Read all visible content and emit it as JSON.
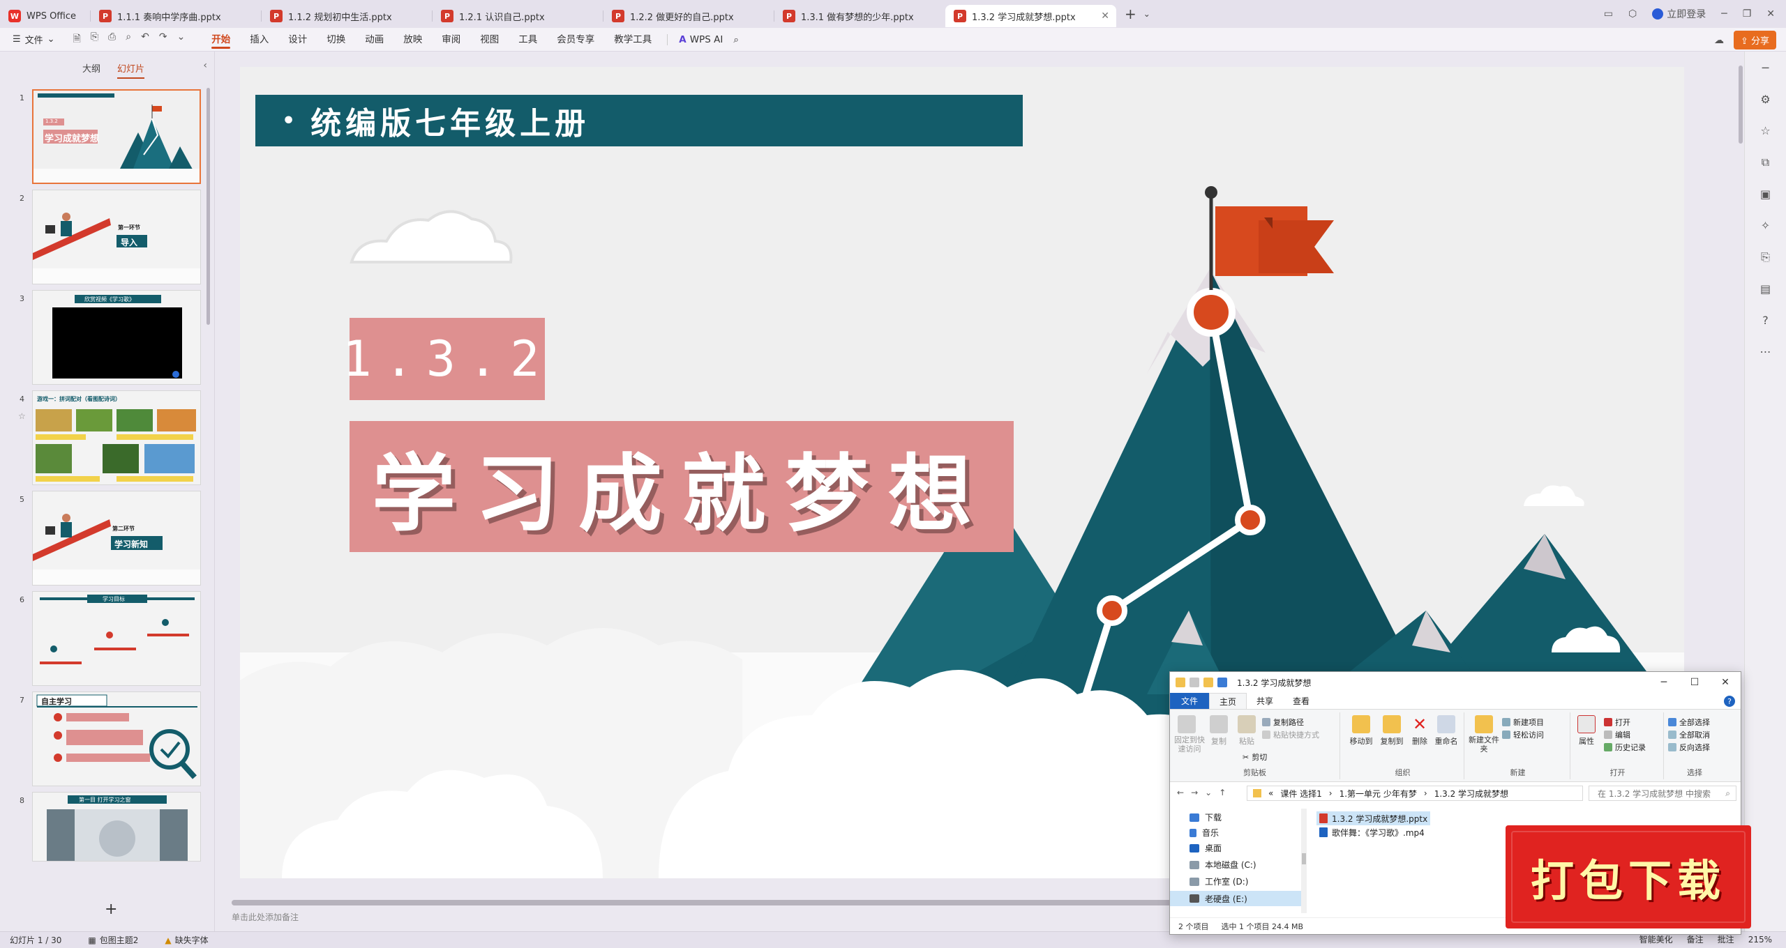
{
  "tabbar": {
    "home_tab": "WPS Office",
    "tabs": [
      {
        "label": "1.1.1 奏响中学序曲.pptx"
      },
      {
        "label": "1.1.2 规划初中生活.pptx"
      },
      {
        "label": "1.2.1 认识自己.pptx"
      },
      {
        "label": "1.2.2 做更好的自己.pptx"
      },
      {
        "label": "1.3.1 做有梦想的少年.pptx"
      },
      {
        "label": "1.3.2 学习成就梦想.pptx"
      }
    ],
    "login_label": "立即登录"
  },
  "menubar": {
    "file_label": "文件",
    "items": [
      "开始",
      "插入",
      "设计",
      "切换",
      "动画",
      "放映",
      "审阅",
      "视图",
      "工具",
      "会员专享",
      "教学工具"
    ],
    "active_item": "开始",
    "ai_label": "WPS AI",
    "share_label": "分享"
  },
  "left_panel": {
    "tab_outline": "大纲",
    "tab_slides": "幻灯片",
    "thumbs": [
      {
        "num": "1",
        "title": "学习成就梦想",
        "num_label": "1.3.2"
      },
      {
        "num": "2",
        "section": "第一环节",
        "label": "导入"
      },
      {
        "num": "3",
        "title": "欣赏视频《学习歌》"
      },
      {
        "num": "4",
        "title": "游戏一：拼词配对（看图配诗词）"
      },
      {
        "num": "5",
        "section": "第二环节",
        "label": "学习新知"
      },
      {
        "num": "6",
        "title": "学习目标"
      },
      {
        "num": "7",
        "title": "自主学习"
      },
      {
        "num": "8",
        "title": "第一目 打开学习之窗"
      }
    ],
    "add_label": "+"
  },
  "slide": {
    "subject": "统编版七年级上册",
    "lesson_number": "1.3.2",
    "lesson_title": "学习成就梦想"
  },
  "notes_placeholder": "单击此处添加备注",
  "statusbar": {
    "slide_count": "幻灯片 1 / 30",
    "theme": "包图主题2",
    "missing_font": "缺失字体",
    "smart_beautify": "智能美化",
    "notes": "备注",
    "comments": "批注",
    "zoom": "215%"
  },
  "explorer": {
    "title": "1.3.2 学习成就梦想",
    "ribbon_tabs": [
      "文件",
      "主页",
      "共享",
      "查看"
    ],
    "groups": {
      "clipboard": "剪贴板",
      "organize": "组织",
      "new": "新建",
      "open": "打开",
      "select": "选择"
    },
    "buttons": {
      "pin": "固定到快速访问",
      "copy": "复制",
      "paste": "粘贴",
      "copy_path": "复制路径",
      "paste_shortcut": "粘贴快捷方式",
      "cut": "剪切",
      "move_to": "移动到",
      "copy_to": "复制到",
      "delete": "删除",
      "rename": "重命名",
      "new_folder": "新建文件夹",
      "new_item": "新建项目",
      "easy_access": "轻松访问",
      "properties": "属性",
      "open": "打开",
      "edit": "编辑",
      "history": "历史记录",
      "select_all": "全部选择",
      "select_none": "全部取消",
      "invert": "反向选择"
    },
    "path": [
      "课件 选择1",
      "1.第一单元 少年有梦",
      "1.3.2 学习成就梦想"
    ],
    "search_placeholder": "在 1.3.2 学习成就梦想 中搜索",
    "nav": [
      "下载",
      "音乐",
      "桌面",
      "本地磁盘 (C:)",
      "工作室 (D:)",
      "老硬盘 (E:)"
    ],
    "nav_selected": "老硬盘 (E:)",
    "files": [
      {
        "name": "1.3.2 学习成就梦想.pptx",
        "type": "pptx",
        "selected": true
      },
      {
        "name": "歌伴舞：《学习歌》.mp4",
        "type": "mp4",
        "selected": false
      }
    ],
    "status_items": "2 个项目",
    "status_selected": "选中 1 个项目  24.4 MB"
  },
  "download_badge": "打包下载"
}
